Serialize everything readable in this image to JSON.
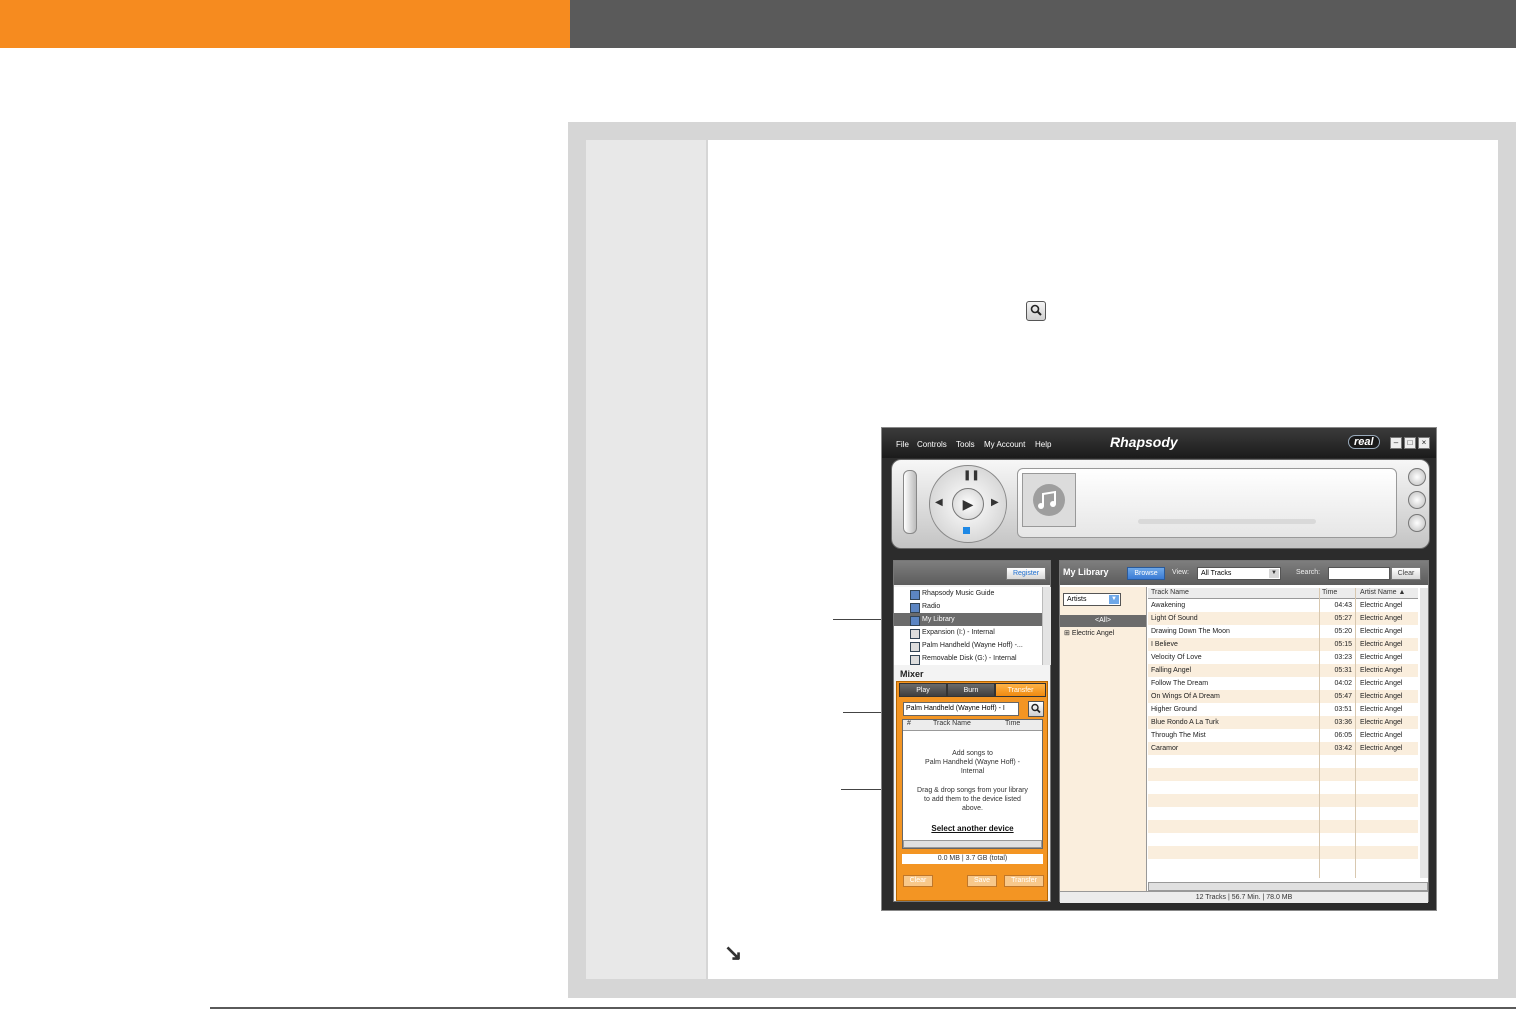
{
  "app": {
    "menu": [
      "File",
      "Controls",
      "Tools",
      "My Account",
      "Help"
    ],
    "logo": "Rhapsody",
    "brand_badge": "real",
    "window_buttons": [
      "minimize",
      "maximize",
      "close"
    ]
  },
  "player": {
    "play_icon": "play-icon",
    "pause_icon": "pause-icon",
    "prev_icon": "previous-icon",
    "next_icon": "next-icon"
  },
  "sidebar": {
    "register_label": "Register",
    "items": [
      {
        "label": "Rhapsody Music Guide"
      },
      {
        "label": "Radio"
      },
      {
        "label": "My Library",
        "selected": true
      },
      {
        "label": "Expansion (I:) - Internal"
      },
      {
        "label": "Palm Handheld (Wayne Hoff) -..."
      },
      {
        "label": "Removable Disk (G:) - Internal"
      }
    ]
  },
  "mixer": {
    "title": "Mixer",
    "tabs": [
      {
        "label": "Play"
      },
      {
        "label": "Burn"
      },
      {
        "label": "Transfer",
        "active": true
      }
    ],
    "device": "Palm Handheld (Wayne Hoff) - I",
    "columns": [
      "#",
      "Track Name",
      "Time"
    ],
    "add_songs_text": "Add songs to",
    "add_songs_device": "Palm Handheld (Wayne Hoff) -",
    "add_songs_device2": "Internal",
    "drag_text1": "Drag & drop songs from your library",
    "drag_text2": "to add them to the device listed",
    "drag_text3": "above.",
    "select_link": "Select another device",
    "size": "0.0 MB | 3.7 GB (total)",
    "clear_label": "Clear",
    "save_label": "Save",
    "transfer_label": "Transfer"
  },
  "library": {
    "title": "My Library",
    "browse_label": "Browse",
    "view_label": "View:",
    "view_value": "All Tracks",
    "search_label": "Search:",
    "search_value": "",
    "clear_label": "Clear",
    "facet_select": "Artists",
    "facet_all": "<All>",
    "facet_artist": "Electric Angel",
    "columns": [
      "Track Name",
      "Time",
      "Artist Name ▲"
    ],
    "tracks": [
      {
        "name": "Awakening",
        "time": "04:43",
        "artist": "Electric Angel"
      },
      {
        "name": "Light Of Sound",
        "time": "05:27",
        "artist": "Electric Angel"
      },
      {
        "name": "Drawing Down The Moon",
        "time": "05:20",
        "artist": "Electric Angel"
      },
      {
        "name": "I Believe",
        "time": "05:15",
        "artist": "Electric Angel"
      },
      {
        "name": "Velocity Of Love",
        "time": "03:23",
        "artist": "Electric Angel"
      },
      {
        "name": "Falling Angel",
        "time": "05:31",
        "artist": "Electric Angel"
      },
      {
        "name": "Follow The Dream",
        "time": "04:02",
        "artist": "Electric Angel"
      },
      {
        "name": "On Wings Of A Dream",
        "time": "05:47",
        "artist": "Electric Angel"
      },
      {
        "name": "Higher Ground",
        "time": "03:51",
        "artist": "Electric Angel"
      },
      {
        "name": "Blue Rondo A La Turk",
        "time": "03:36",
        "artist": "Electric Angel"
      },
      {
        "name": "Through The Mist",
        "time": "06:05",
        "artist": "Electric Angel"
      },
      {
        "name": "Caramor",
        "time": "03:42",
        "artist": "Electric Angel"
      }
    ],
    "status": "12 Tracks | 56.7 Min. | 78.0 MB"
  },
  "page": {
    "next_arrow": "↘"
  },
  "colors": {
    "accent_orange": "#f68b1f",
    "header_gray": "#5a5a5a"
  }
}
